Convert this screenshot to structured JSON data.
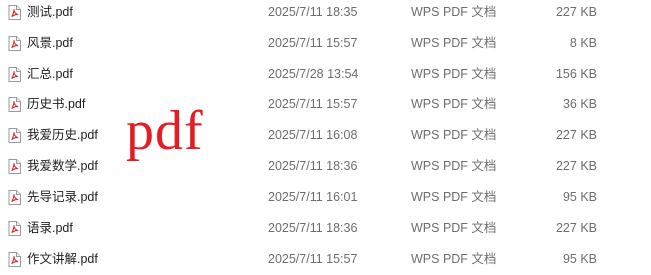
{
  "file_list": {
    "rows": [
      {
        "name": "测试.pdf",
        "modified": "2025/7/11 18:35",
        "type": "WPS PDF 文档",
        "size": "227 KB",
        "icon": "pdf-file-icon"
      },
      {
        "name": "风景.pdf",
        "modified": "2025/7/11 15:57",
        "type": "WPS PDF 文档",
        "size": "8 KB",
        "icon": "pdf-file-icon"
      },
      {
        "name": "汇总.pdf",
        "modified": "2025/7/28 13:54",
        "type": "WPS PDF 文档",
        "size": "156 KB",
        "icon": "pdf-file-icon"
      },
      {
        "name": "历史书.pdf",
        "modified": "2025/7/11 15:57",
        "type": "WPS PDF 文档",
        "size": "36 KB",
        "icon": "pdf-file-icon"
      },
      {
        "name": "我爱历史.pdf",
        "modified": "2025/7/11 16:08",
        "type": "WPS PDF 文档",
        "size": "227 KB",
        "icon": "pdf-file-icon"
      },
      {
        "name": "我爱数学.pdf",
        "modified": "2025/7/11 18:36",
        "type": "WPS PDF 文档",
        "size": "227 KB",
        "icon": "pdf-file-icon"
      },
      {
        "name": "先导记录.pdf",
        "modified": "2025/7/11 16:01",
        "type": "WPS PDF 文档",
        "size": "95 KB",
        "icon": "pdf-file-icon"
      },
      {
        "name": "语录.pdf",
        "modified": "2025/7/11 18:36",
        "type": "WPS PDF 文档",
        "size": "227 KB",
        "icon": "pdf-file-icon"
      },
      {
        "name": "作文讲解.pdf",
        "modified": "2025/7/11 15:57",
        "type": "WPS PDF 文档",
        "size": "95 KB",
        "icon": "pdf-file-icon"
      }
    ]
  },
  "overlay": {
    "text": "pdf",
    "color": "#e51c23"
  },
  "colors": {
    "icon_accent": "#d9262c",
    "text_primary": "#222222",
    "text_secondary": "#6d6d6d"
  }
}
